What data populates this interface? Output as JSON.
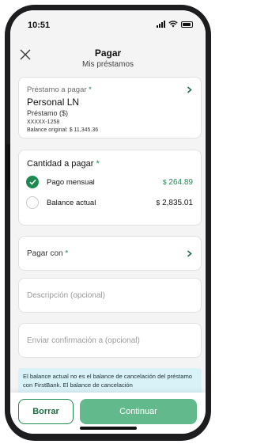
{
  "status_bar": {
    "time": "10:51"
  },
  "header": {
    "title": "Pagar",
    "subtitle": "Mis préstamos"
  },
  "loan": {
    "label": "Préstamo a pagar",
    "required_mark": "*",
    "name": "Personal LN",
    "type": "Préstamo ($)",
    "account": "XXXXX-1258",
    "original_balance": "Balance original: $ 11,345.36"
  },
  "amount": {
    "title": "Cantidad a pagar",
    "required_mark": "*",
    "options": [
      {
        "label": "Pago mensual",
        "currency": "$",
        "value": "264.89",
        "selected": true
      },
      {
        "label": "Balance actual",
        "currency": "$",
        "value": "2,835.01",
        "selected": false
      }
    ]
  },
  "pay_with": {
    "label": "Pagar con",
    "required_mark": "*"
  },
  "description": {
    "placeholder": "Descripción (opcional)"
  },
  "confirmation": {
    "placeholder": "Enviar confirmación a (opcional)"
  },
  "info_banner": "El balance actual no es el balance de cancelación del préstamo con FirstBank. El balance de cancelación",
  "actions": {
    "clear": "Borrar",
    "continue": "Continuar"
  },
  "colors": {
    "accent": "#1d8a52",
    "continue_bg": "#62b98b",
    "banner_bg": "#d9f2f8"
  },
  "icons": {
    "close": "close-icon",
    "chevron": "chevron-right-icon",
    "check": "check-icon",
    "signal": "signal-icon",
    "wifi": "wifi-icon",
    "battery": "battery-icon"
  }
}
